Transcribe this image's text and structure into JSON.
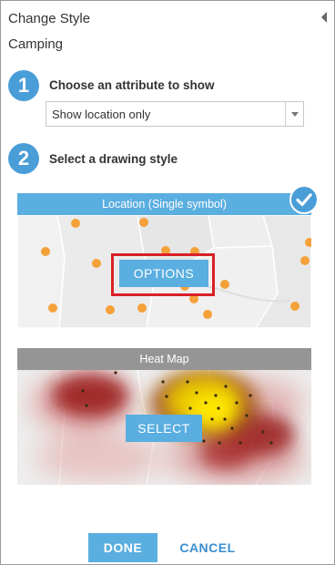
{
  "panel": {
    "title": "Change Style",
    "layer_name": "Camping"
  },
  "step1": {
    "number": "1",
    "label": "Choose an attribute to show",
    "select_value": "Show location only"
  },
  "step2": {
    "number": "2",
    "label": "Select a drawing style"
  },
  "styles": [
    {
      "title": "Location (Single symbol)",
      "button": "OPTIONS",
      "selected": true
    },
    {
      "title": "Heat Map",
      "button": "SELECT",
      "selected": false
    }
  ],
  "footer": {
    "done_label": "DONE",
    "cancel_label": "CANCEL"
  },
  "colors": {
    "accent": "#4a9ed8",
    "button": "#5aaee0",
    "point": "#f5a13a",
    "highlight": "#d92027"
  },
  "icons": {
    "collapse": "collapse-arrow-icon",
    "check": "checkmark-icon",
    "dropdown": "chevron-down-icon"
  }
}
